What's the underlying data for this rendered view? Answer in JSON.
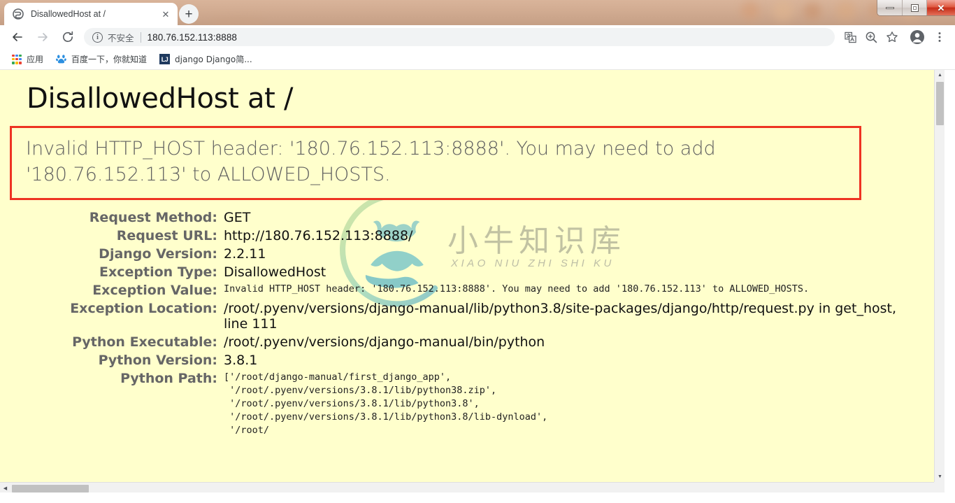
{
  "window": {
    "controls": [
      {
        "name": "minimize",
        "glyph": "minimize-icon"
      },
      {
        "name": "restore",
        "glyph": "restore-icon"
      },
      {
        "name": "close",
        "glyph": "✕"
      }
    ]
  },
  "tabs": [
    {
      "title": "DisallowedHost at /",
      "favicon": "globe-icon",
      "close": "✕"
    }
  ],
  "newtab_label": "+",
  "toolbar": {
    "back": "←",
    "forward": "→",
    "reload": "⟳",
    "security_badge": "不安全",
    "url": "180.76.152.113:8888",
    "info_glyph": "i",
    "translate": "translate-icon",
    "zoom": "zoom-icon",
    "bookmark_star": "☆",
    "profile": "profile-icon",
    "menu": "⋮"
  },
  "bookmarks": [
    {
      "label": "应用",
      "icon": "apps-grid-icon"
    },
    {
      "label": "百度一下，你就知道",
      "icon": "baidu-icon"
    },
    {
      "label": "django Django简...",
      "icon": "lj-icon"
    }
  ],
  "page": {
    "title": "DisallowedHost at /",
    "error_message": "Invalid HTTP_HOST header: '180.76.152.113:8888'. You may need to add '180.76.152.113' to ALLOWED_HOSTS.",
    "rows": [
      {
        "label": "Request Method:",
        "value": "GET",
        "mono": false
      },
      {
        "label": "Request URL:",
        "value": "http://180.76.152.113:8888/",
        "mono": false
      },
      {
        "label": "Django Version:",
        "value": "2.2.11",
        "mono": false
      },
      {
        "label": "Exception Type:",
        "value": "DisallowedHost",
        "mono": false
      },
      {
        "label": "Exception Value:",
        "value": "Invalid HTTP_HOST header: '180.76.152.113:8888'. You may need to add '180.76.152.113' to ALLOWED_HOSTS.",
        "mono": true
      },
      {
        "label": "Exception Location:",
        "value": "/root/.pyenv/versions/django-manual/lib/python3.8/site-packages/django/http/request.py in get_host, line 111",
        "mono": false
      },
      {
        "label": "Python Executable:",
        "value": "/root/.pyenv/versions/django-manual/bin/python",
        "mono": false
      },
      {
        "label": "Python Version:",
        "value": "3.8.1",
        "mono": false
      },
      {
        "label": "Python Path:",
        "value": "['/root/django-manual/first_django_app',\n '/root/.pyenv/versions/3.8.1/lib/python38.zip',\n '/root/.pyenv/versions/3.8.1/lib/python3.8',\n '/root/.pyenv/versions/3.8.1/lib/python3.8/lib-dynload',\n '/root/",
        "mono": true
      }
    ],
    "watermark": {
      "cn": "小牛知识库",
      "en": "XIAO NIU ZHI SHI KU"
    }
  },
  "colors": {
    "page_bg": "#ffffcc",
    "error_border": "#ee3322",
    "label_gray": "#666666",
    "title_bar": "#cfa98f"
  },
  "scrollbars": {
    "up_arrow": "▲",
    "down_arrow": "▼",
    "left_arrow": "◀",
    "right_arrow": "▶"
  }
}
